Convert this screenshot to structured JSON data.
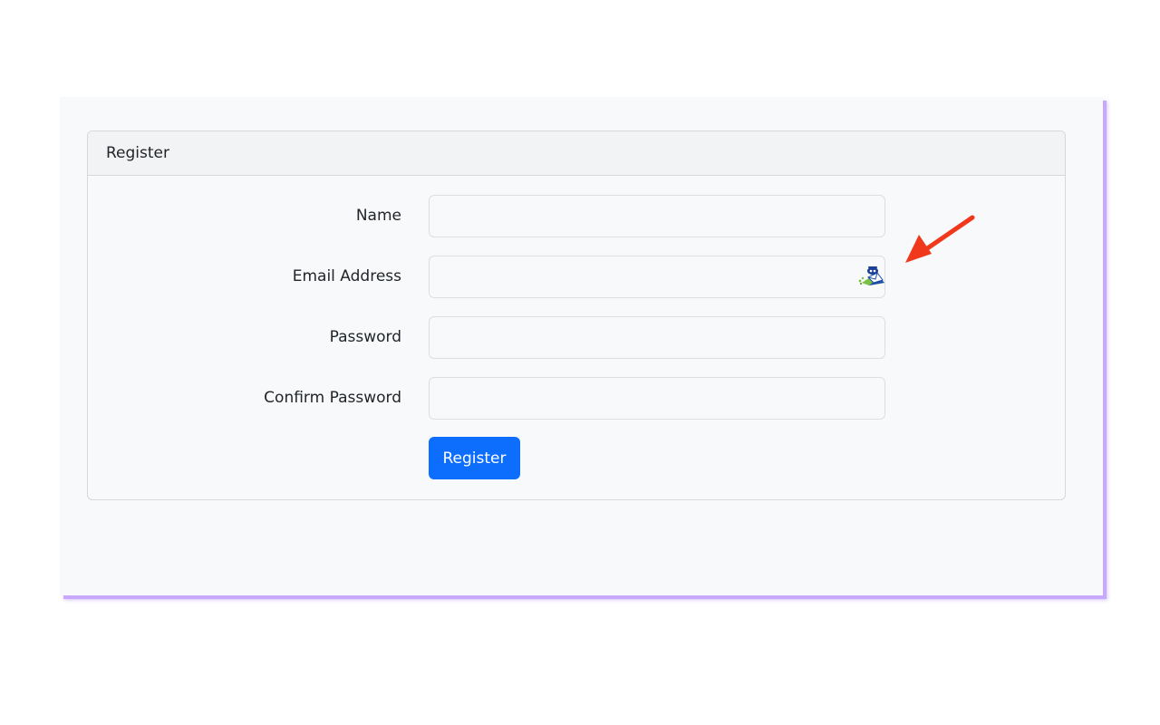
{
  "card": {
    "title": "Register"
  },
  "form": {
    "fields": [
      {
        "label": "Name",
        "value": "",
        "placeholder": ""
      },
      {
        "label": "Email Address",
        "value": "",
        "placeholder": ""
      },
      {
        "label": "Password",
        "value": "",
        "placeholder": ""
      },
      {
        "label": "Confirm Password",
        "value": "",
        "placeholder": ""
      }
    ],
    "submit_label": "Register"
  },
  "icons": {
    "email_extension": "mail-extension-icon",
    "annotation": "red-arrow-icon"
  },
  "colors": {
    "primary": "#0d6efd",
    "arrow": "#f0391c",
    "frame_shadow": "#c7a8fb"
  }
}
